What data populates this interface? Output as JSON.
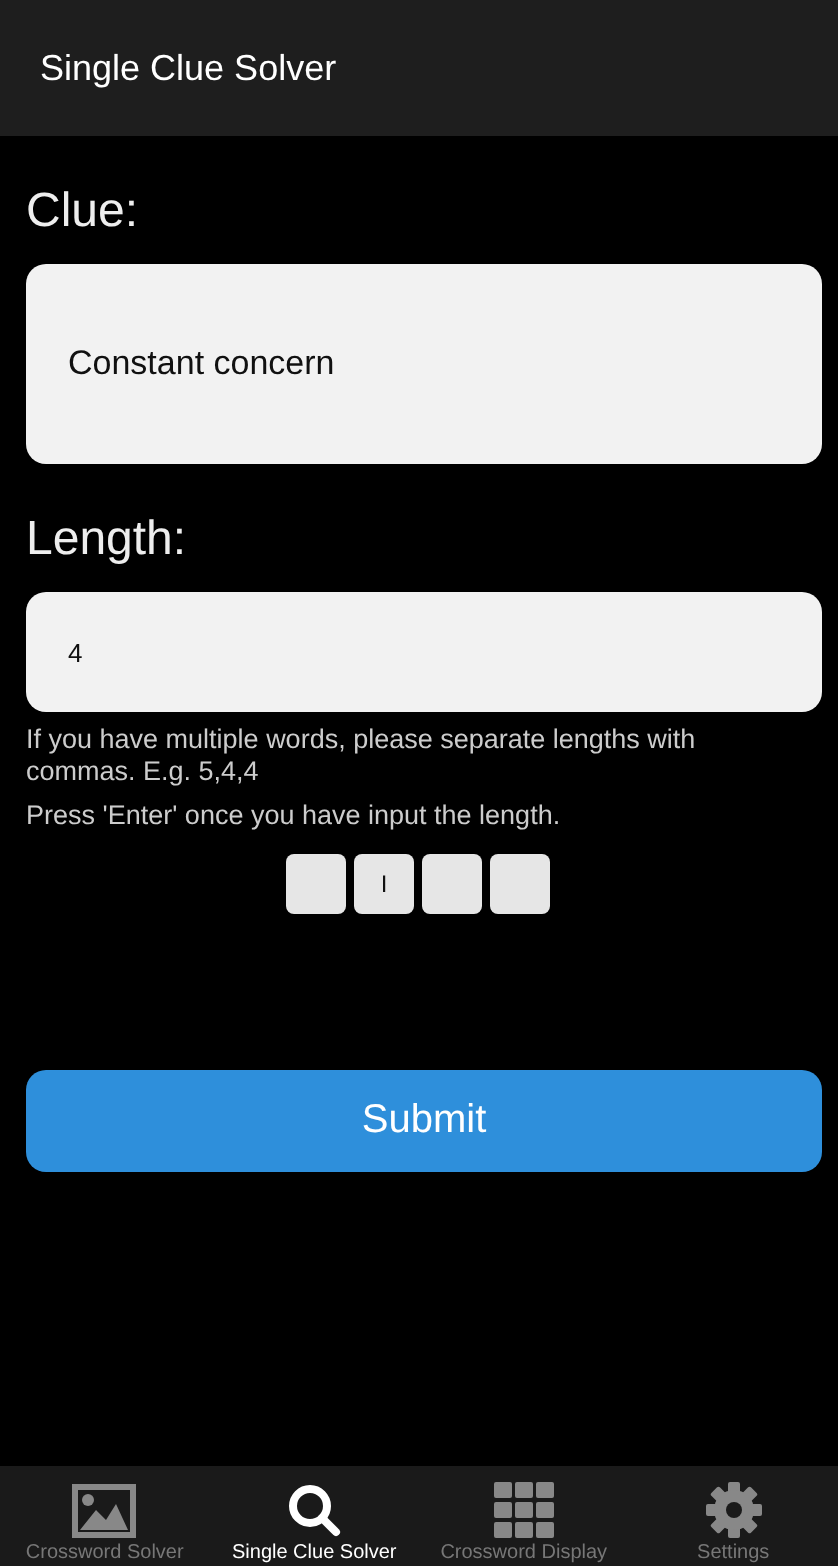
{
  "app_bar": {
    "title": "Single Clue Solver"
  },
  "clue": {
    "label": "Clue:",
    "value": "Constant concern"
  },
  "length": {
    "label": "Length:",
    "value": "4"
  },
  "hints": [
    "If you have multiple words, please separate lengths with commas. E.g. 5,4,4",
    "Press 'Enter' once you have input the length."
  ],
  "letter_boxes": [
    {
      "kind": "empty"
    },
    {
      "kind": "letter",
      "letter": "I"
    },
    {
      "kind": "empty"
    },
    {
      "kind": "empty"
    }
  ],
  "submit": {
    "label": "Submit"
  },
  "nav": [
    {
      "label": "Crossword Solver",
      "kind": "image",
      "selected": false
    },
    {
      "label": "Single Clue Solver",
      "kind": "search",
      "selected": true
    },
    {
      "label": "Crossword Display",
      "kind": "grid",
      "selected": false
    },
    {
      "label": "Settings",
      "kind": "gear",
      "selected": false
    }
  ]
}
